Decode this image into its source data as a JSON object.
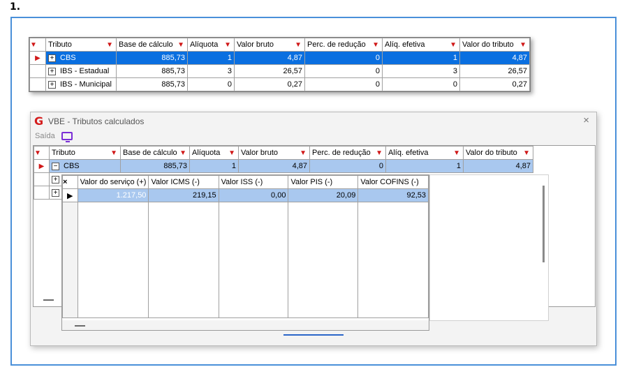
{
  "step": "1.",
  "columns": [
    "Tributo",
    "Base de cálculo",
    "Alíquota",
    "Valor bruto",
    "Perc. de redução",
    "Alíq. efetiva",
    "Valor do tributo"
  ],
  "rows": [
    [
      "CBS",
      "885,73",
      "1",
      "4,87",
      "0",
      "1",
      "4,87"
    ],
    [
      "IBS - Estadual",
      "885,73",
      "3",
      "26,57",
      "0",
      "3",
      "26,57"
    ],
    [
      "IBS - Municipal",
      "885,73",
      "0",
      "0,27",
      "0",
      "0",
      "0,27"
    ]
  ],
  "window": {
    "title": "VBE - Tributos calculados",
    "menu_saida": "Saída",
    "app_icon": "G"
  },
  "detail": {
    "columns": [
      "Valor do serviço (+)",
      "Valor ICMS (-)",
      "Valor ISS (-)",
      "Valor PIS (-)",
      "Valor COFINS (-)"
    ],
    "row": [
      "1.217,50",
      "219,15",
      "0,00",
      "20,09",
      "92,53"
    ],
    "close_glyph": "×"
  },
  "icons": {
    "expand": "+",
    "collapse": "−",
    "row_indicator": "triangle-right",
    "filter": "funnel",
    "close": "×"
  },
  "colors": {
    "frame_border": "#4a90d9",
    "selection": "#0a6fe0",
    "selection_light": "#a9c8ef",
    "filter_red": "#d01818",
    "app_red": "#d41c1c",
    "tv_purple": "#7a2ed6"
  }
}
